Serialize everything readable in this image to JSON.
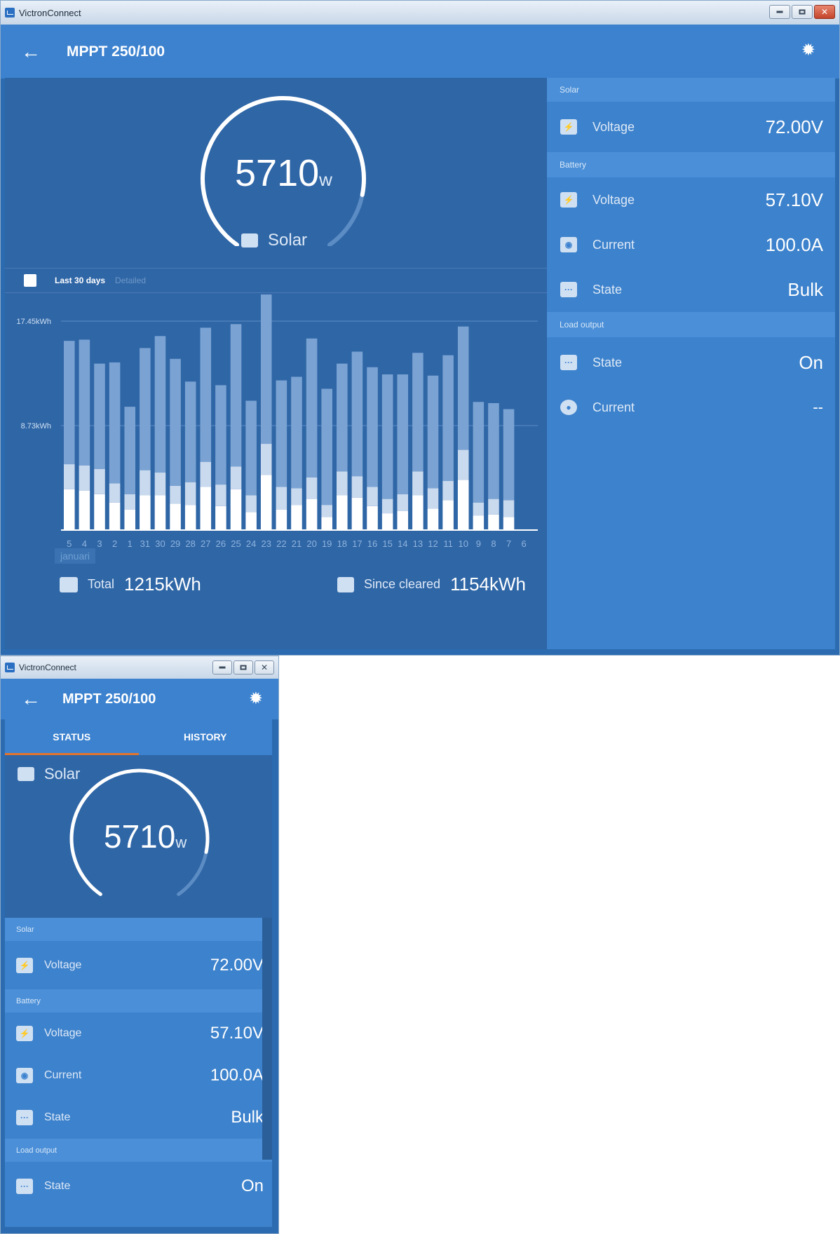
{
  "colors": {
    "accent": "#3c82cf",
    "panel": "#2f66a6",
    "tab_indicator": "#e2742c"
  },
  "win1": {
    "title": "VictronConnect",
    "device": "MPPT 250/100",
    "gauge": {
      "value": "5710",
      "unit": "w",
      "label": "Solar",
      "fraction": 0.85
    },
    "toolbar": {
      "range": "Last 30 days",
      "detail": "Detailed"
    },
    "totals": {
      "total_label": "Total",
      "total_value": "1215kWh",
      "cleared_label": "Since cleared",
      "cleared_value": "1154kWh"
    },
    "month": "januari"
  },
  "sections": {
    "solar": "Solar",
    "battery": "Battery",
    "load": "Load output",
    "solar_voltage_label": "Voltage",
    "solar_voltage": "72.00V",
    "batt_voltage_label": "Voltage",
    "batt_voltage": "57.10V",
    "batt_current_label": "Current",
    "batt_current": "100.0A",
    "batt_state_label": "State",
    "batt_state": "Bulk",
    "load_state_label": "State",
    "load_state": "On",
    "load_current_label": "Current",
    "load_current": "--"
  },
  "win2": {
    "title": "VictronConnect",
    "device": "MPPT 250/100",
    "tab_status": "STATUS",
    "tab_history": "HISTORY",
    "gauge": {
      "value": "5710",
      "unit": "w",
      "label": "Solar",
      "fraction": 0.85
    }
  },
  "chart_data": {
    "type": "bar",
    "categories": [
      "5",
      "4",
      "3",
      "2",
      "1",
      "31",
      "30",
      "29",
      "28",
      "27",
      "26",
      "25",
      "24",
      "23",
      "22",
      "21",
      "20",
      "19",
      "18",
      "17",
      "16",
      "15",
      "14",
      "13",
      "12",
      "11",
      "10",
      "9",
      "8",
      "7",
      "6"
    ],
    "y_ticks": [
      "17.45kWh",
      "8.73kWh"
    ],
    "ylim": [
      0,
      17.45
    ],
    "series": [
      {
        "values": [
          3.4,
          3.3,
          3.0,
          2.3,
          1.7,
          2.9,
          2.9,
          2.2,
          2.1,
          3.6,
          2.0,
          3.4,
          1.5,
          4.6,
          1.7,
          2.1,
          2.6,
          1.1,
          2.9,
          2.7,
          2.0,
          1.4,
          1.6,
          2.9,
          1.8,
          2.5,
          4.2,
          1.2,
          1.3,
          1.1,
          0.0
        ]
      },
      {
        "values": [
          2.1,
          2.1,
          2.1,
          1.6,
          1.3,
          2.1,
          1.9,
          1.5,
          1.9,
          2.1,
          1.8,
          1.9,
          1.4,
          2.6,
          1.9,
          1.4,
          1.8,
          1.0,
          2.0,
          1.8,
          1.6,
          1.2,
          1.4,
          2.0,
          1.7,
          1.6,
          2.5,
          1.1,
          1.3,
          1.4,
          0.0
        ]
      },
      {
        "values": [
          10.3,
          10.5,
          8.8,
          10.1,
          7.3,
          10.2,
          11.4,
          10.6,
          8.4,
          11.2,
          8.3,
          11.9,
          7.9,
          13.3,
          8.9,
          9.3,
          11.6,
          9.7,
          9.0,
          10.4,
          10.0,
          10.4,
          10.0,
          9.9,
          9.4,
          10.5,
          10.3,
          8.4,
          8.0,
          7.6,
          0.0
        ]
      }
    ]
  }
}
